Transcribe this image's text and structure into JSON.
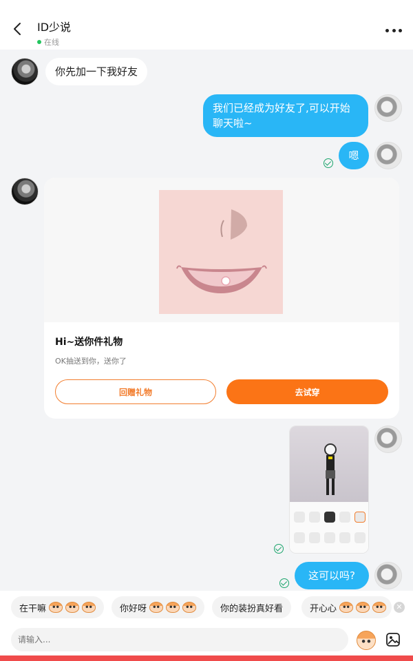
{
  "header": {
    "title": "ID少说",
    "status": "在线"
  },
  "messages": {
    "m1": "你先加一下我好友",
    "m2": "我们已经成为好友了,可以开始聊天啦~",
    "m3": "嗯",
    "m5": "这可以吗?"
  },
  "gift": {
    "title": "Hi~送你件礼物",
    "subtitle": "OK抽送到你，送你了",
    "btn_return": "回赠礼物",
    "btn_try": "去试穿"
  },
  "quick_replies": [
    "在干嘛",
    "你好呀",
    "你的装扮真好看",
    "开心心"
  ],
  "input": {
    "placeholder": "请输入..."
  },
  "colors": {
    "accent_orange": "#fb7416",
    "bubble_blue": "#29b6f6",
    "online_green": "#22c55e",
    "bottom_red": "#f04b4b"
  }
}
